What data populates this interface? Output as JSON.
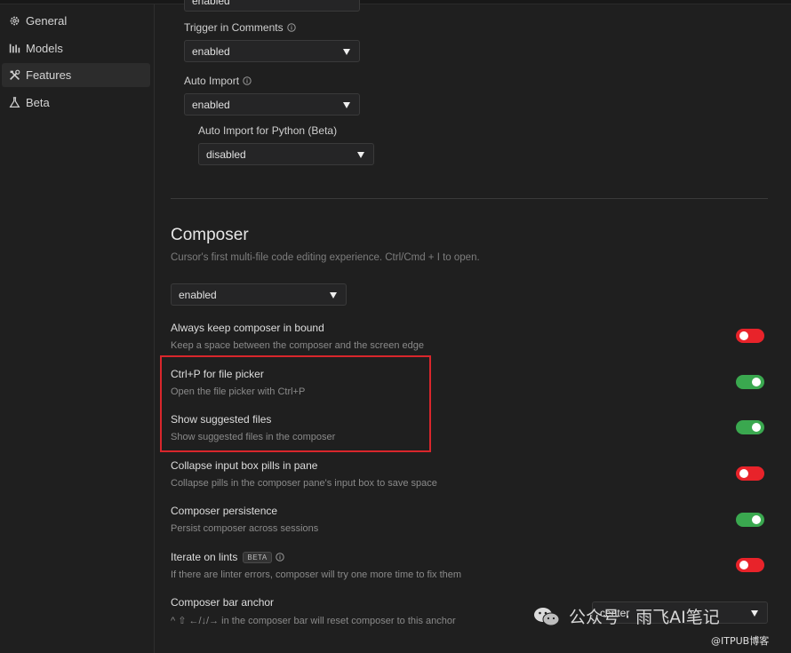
{
  "sidebar": {
    "items": [
      {
        "label": "General",
        "icon": "gear-icon"
      },
      {
        "label": "Models",
        "icon": "models-icon"
      },
      {
        "label": "Features",
        "icon": "tools-icon"
      },
      {
        "label": "Beta",
        "icon": "flask-icon"
      }
    ],
    "active": "Features"
  },
  "settings_top": {
    "clipped_select_value": "enabled",
    "trigger_in_comments": {
      "label": "Trigger in Comments",
      "value": "enabled"
    },
    "auto_import": {
      "label": "Auto Import",
      "value": "enabled"
    },
    "auto_import_python": {
      "label": "Auto Import for Python (Beta)",
      "value": "disabled"
    }
  },
  "composer": {
    "title": "Composer",
    "description": "Cursor's first multi-file code editing experience. Ctrl/Cmd + I to open.",
    "select_value": "enabled",
    "options": [
      {
        "title": "Always keep composer in bound",
        "desc": "Keep a space between the composer and the screen edge",
        "state": "off"
      },
      {
        "title": "Ctrl+P for file picker",
        "desc": "Open the file picker with Ctrl+P",
        "state": "on"
      },
      {
        "title": "Show suggested files",
        "desc": "Show suggested files in the composer",
        "state": "on"
      },
      {
        "title": "Collapse input box pills in pane",
        "desc": "Collapse pills in the composer pane's input box to save space",
        "state": "off"
      },
      {
        "title": "Composer persistence",
        "desc": "Persist composer across sessions",
        "state": "on"
      },
      {
        "title": "Iterate on lints",
        "badge": "BETA",
        "desc": "If there are linter errors, composer will try one more time to fix them",
        "state": "off"
      },
      {
        "title": "Composer bar anchor",
        "desc": "^ ⇧ ←/↓/→ in the composer bar will reset composer to this anchor"
      }
    ],
    "anchor_select_value": "center"
  },
  "colors": {
    "toggle_on": "#3aa84f",
    "toggle_off": "#e8232a",
    "highlight": "#d9262c"
  },
  "watermark": {
    "text": "公众号 · 雨飞AI笔记",
    "sub": "@ITPUB博客"
  }
}
